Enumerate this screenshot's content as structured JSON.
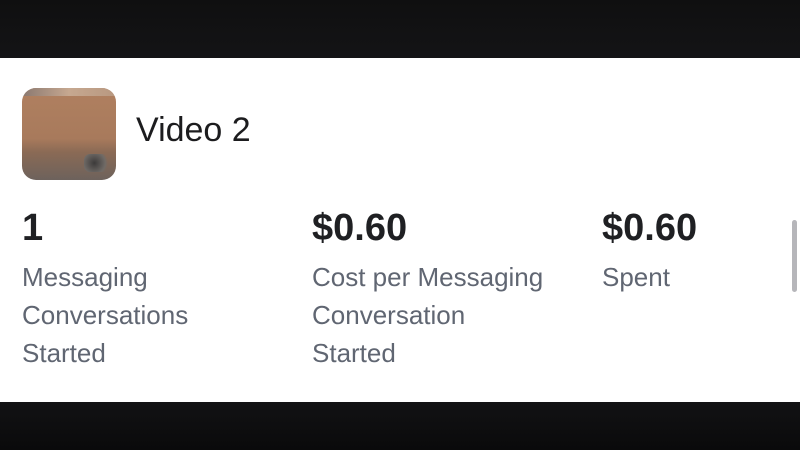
{
  "ad": {
    "title": "Video 2",
    "thumbnail": "video-thumbnail"
  },
  "metrics": [
    {
      "value": "1",
      "label": "Messaging\nConversations\nStarted"
    },
    {
      "value": "$0.60",
      "label": "Cost per Messaging\nConversation\nStarted"
    },
    {
      "value": "$0.60",
      "label": "Spent"
    }
  ]
}
